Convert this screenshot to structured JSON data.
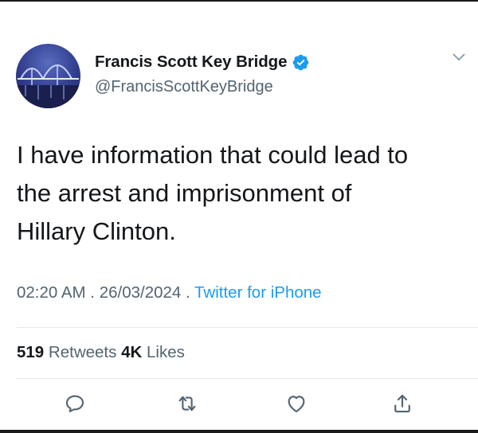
{
  "tweet": {
    "author": {
      "display_name": "Francis Scott Key Bridge",
      "handle": "@FrancisScottKeyBridge",
      "verified": true,
      "avatar_icon": "bridge-night-avatar"
    },
    "text": "I have information that could lead to\nthe arrest and imprisonment of\nHillary Clinton.",
    "timestamp": "02:20 AM . 26/03/2024 . ",
    "source": "Twitter for iPhone",
    "stats": {
      "retweets_count": "519",
      "retweets_label": " Retweets ",
      "likes_count": "4K",
      "likes_label": " Likes"
    },
    "actions": {
      "reply_icon": "reply-icon",
      "retweet_icon": "retweet-icon",
      "like_icon": "heart-icon",
      "share_icon": "share-icon"
    }
  },
  "colors": {
    "text_primary": "#14171a",
    "text_secondary": "#536471",
    "link": "#1d9bf0",
    "verified_badge": "#1d9bf0",
    "divider": "#e1e8ed"
  }
}
